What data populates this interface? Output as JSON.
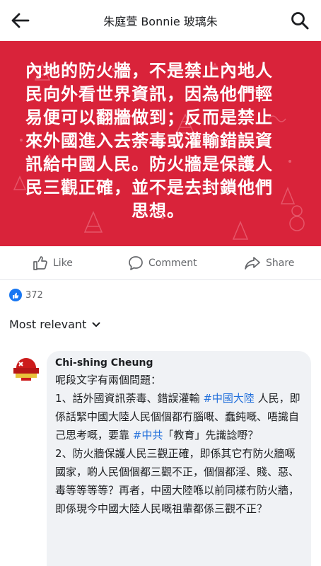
{
  "header": {
    "title": "朱庭萱 Bonnie 玻璃朱",
    "back_icon": "arrow-left-icon",
    "search_icon": "search-icon"
  },
  "post": {
    "image_text": "內地的防火牆，不是禁止內地人民向外看世界資訊，因為他們輕易便可以翻牆做到；反而是禁止來外國進入去荼毒或灌輸錯誤資訊給中國人民。防火牆是保護人民三觀正確，並不是去封鎖他們思想。",
    "image_lines": [
      "內地的防火牆，不是禁止內地人",
      "民向外看世界資訊，因為他們輕",
      "易便可以翻牆做到；反而是禁止",
      "來外國進入去荼毒或灌輸錯誤資",
      "訊給中國人民。防火牆是保護人",
      "民三觀正確，並不是去封鎖他們",
      "思想。"
    ],
    "banner_color": "#d9233a"
  },
  "actions": {
    "like_label": "Like",
    "comment_label": "Comment",
    "share_label": "Share"
  },
  "reactions": {
    "count": "372"
  },
  "sort": {
    "label": "Most relevant"
  },
  "comment": {
    "author": "Chi-shing Cheung",
    "intro": "呢段文字有兩個問題：",
    "p1_a": "1、話外國資訊荼毒、錯誤灌輸 ",
    "p1_tag1": "#中國大陸",
    "p1_b": " 人民，即係話緊中國大陸人民個個都冇腦嘅、蠢鈍嘅、唔識自己思考嘅，要靠 ",
    "p1_tag2": "#中共",
    "p1_c": "「教育」先識諗嘢？",
    "p2": "2、防火牆保護人民三觀正確，即係其它冇防火牆嘅國家，啲人民個個都三觀不正，個個都淫、賤、惡、毒等等等等？再者，中國大陸喺以前同樣冇防火牆，即係現今中國大陸人民嘅祖輩都係三觀不正？"
  }
}
